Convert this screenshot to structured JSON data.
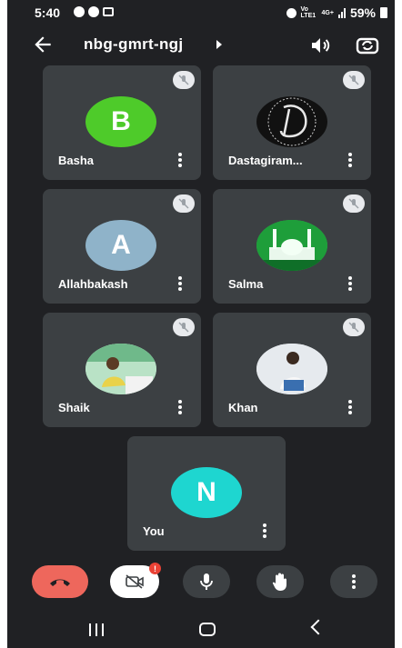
{
  "status_bar": {
    "time": "5:40",
    "network_label": "Vo LTE1",
    "network_type": "4G+",
    "battery": "59%"
  },
  "header": {
    "meeting_code": "nbg-gmrt-ngj"
  },
  "participants": [
    {
      "name": "Basha",
      "initial": "B",
      "avatar_color": "#4ecb2a",
      "muted": true
    },
    {
      "name": "Dastagiram...",
      "initial": "",
      "avatar_color": "#111111",
      "muted": true
    },
    {
      "name": "Allahbakash",
      "initial": "A",
      "avatar_color": "#8fb3c9",
      "muted": true
    },
    {
      "name": "Salma",
      "initial": "",
      "avatar_color": "#2db84a",
      "muted": true
    },
    {
      "name": "Shaik",
      "initial": "",
      "avatar_color": "#9ccfb3",
      "muted": true
    },
    {
      "name": "Khan",
      "initial": "",
      "avatar_color": "#d7dde2",
      "muted": true
    }
  ],
  "self": {
    "name": "You",
    "initial": "N",
    "avatar_color": "#1ed6d0"
  },
  "controls": {
    "end_call_color": "#ee675c",
    "camera_badge": "!"
  },
  "colors": {
    "background": "#202124",
    "tile": "#3c4043",
    "control_button": "#3c4043"
  }
}
